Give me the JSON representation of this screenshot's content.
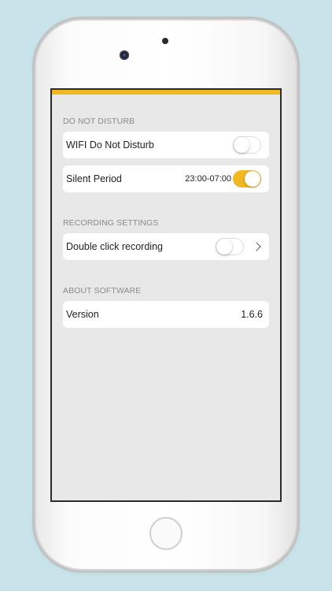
{
  "sections": [
    {
      "header": "DO NOT DISTURB",
      "rows": [
        {
          "label": "WIFI Do Not Disturb",
          "toggle": false
        },
        {
          "label": "Silent Period",
          "value": "23:00-07:00",
          "toggle": true
        }
      ]
    },
    {
      "header": "RECORDING SETTINGS",
      "rows": [
        {
          "label": "Double click recording",
          "toggle": false,
          "chevron": true
        }
      ]
    },
    {
      "header": "ABOUT SOFTWARE",
      "rows": [
        {
          "label": "Version",
          "value": "1.6.6"
        }
      ]
    }
  ],
  "colors": {
    "accent": "#f0b823",
    "background": "#c8e4ea",
    "screen_bg": "#e8e8e8"
  }
}
